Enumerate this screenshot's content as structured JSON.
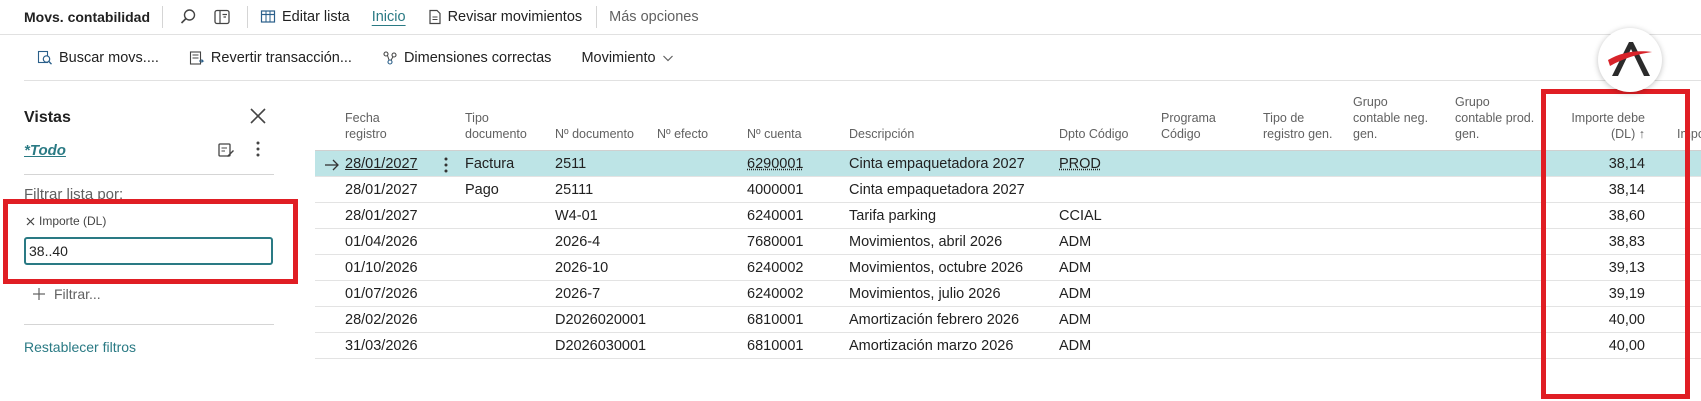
{
  "page": {
    "title": "Movs. contabilidad"
  },
  "topbar": {
    "edit_list": "Editar lista",
    "home": "Inicio",
    "review": "Revisar movimientos",
    "more": "Más opciones"
  },
  "actions": {
    "search": "Buscar movs....",
    "reverse": "Revertir transacción...",
    "dimensions": "Dimensiones correctas",
    "movement": "Movimiento"
  },
  "filter_pane": {
    "title": "Vistas",
    "view": "*Todo",
    "filter_by": "Filtrar lista por:",
    "field_name": "Importe (DL)",
    "field_value": "38..40",
    "add_filter": "Filtrar...",
    "reset": "Restablecer filtros"
  },
  "table": {
    "headers": {
      "date": [
        "Fecha",
        "registro"
      ],
      "doctype": [
        "Tipo",
        "documento"
      ],
      "docno": "Nº documento",
      "effect": "Nº efecto",
      "account": "Nº cuenta",
      "desc": "Descripción",
      "dept": "Dpto Código",
      "program": [
        "Programa",
        "Código"
      ],
      "regtype": [
        "Tipo de",
        "registro gen."
      ],
      "busgroup": [
        "Grupo",
        "contable neg.",
        "gen."
      ],
      "prodgroup": [
        "Grupo",
        "contable prod.",
        "gen."
      ],
      "debit": [
        "Importe debe",
        "(DL) ↑"
      ],
      "next": "Impo"
    },
    "rows": [
      {
        "date": "28/01/2027",
        "doctype": "Factura",
        "docno": "2511",
        "account": "6290001",
        "desc": "Cinta empaquetadora 2027",
        "dept": "PROD",
        "debit": "38,14"
      },
      {
        "date": "28/01/2027",
        "doctype": "Pago",
        "docno": "25111",
        "account": "4000001",
        "desc": "Cinta empaquetadora 2027",
        "dept": "",
        "debit": "38,14"
      },
      {
        "date": "28/01/2027",
        "doctype": "",
        "docno": "W4-01",
        "account": "6240001",
        "desc": "Tarifa parking",
        "dept": "CCIAL",
        "debit": "38,60"
      },
      {
        "date": "01/04/2026",
        "doctype": "",
        "docno": "2026-4",
        "account": "7680001",
        "desc": "Movimientos, abril 2026",
        "dept": "ADM",
        "debit": "38,83"
      },
      {
        "date": "01/10/2026",
        "doctype": "",
        "docno": "2026-10",
        "account": "6240002",
        "desc": "Movimientos, octubre 2026",
        "dept": "ADM",
        "debit": "39,13"
      },
      {
        "date": "01/07/2026",
        "doctype": "",
        "docno": "2026-7",
        "account": "6240002",
        "desc": "Movimientos, julio 2026",
        "dept": "ADM",
        "debit": "39,19"
      },
      {
        "date": "28/02/2026",
        "doctype": "",
        "docno": "D2026020001",
        "account": "6810001",
        "desc": "Amortización febrero 2026",
        "dept": "ADM",
        "debit": "40,00"
      },
      {
        "date": "31/03/2026",
        "doctype": "",
        "docno": "D2026030001",
        "account": "6810001",
        "desc": "Amortización marzo 2026",
        "dept": "ADM",
        "debit": "40,00"
      }
    ]
  },
  "colors": {
    "accent": "#2a7a84",
    "selected_row": "#bde4e6",
    "highlight_box": "#e01e24"
  }
}
